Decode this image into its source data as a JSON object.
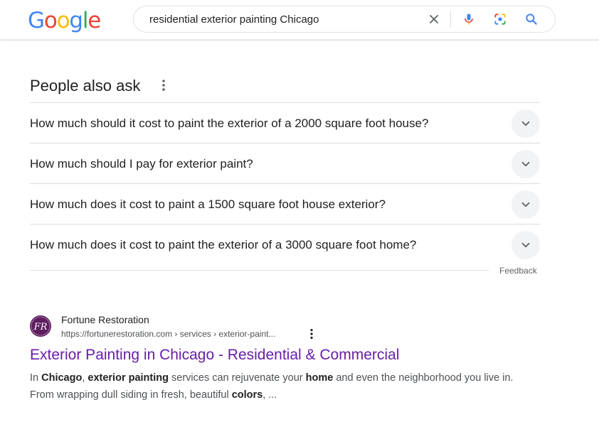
{
  "logo": {
    "letters": [
      "G",
      "o",
      "o",
      "g",
      "l",
      "e"
    ],
    "colors": [
      "#4285F4",
      "#EA4335",
      "#FBBC05",
      "#4285F4",
      "#34A853",
      "#EA4335"
    ]
  },
  "search": {
    "query": "residential exterior painting Chicago",
    "icons": [
      "close-icon",
      "microphone-icon",
      "google-lens-icon",
      "search-icon"
    ]
  },
  "people_also_ask": {
    "title": "People also ask",
    "menu_icon": "more-vertical-icon",
    "questions": [
      "How much should it cost to paint the exterior of a 2000 square foot house?",
      "How much should I pay for exterior paint?",
      "How much does it cost to paint a 1500 square foot house exterior?",
      "How much does it cost to paint the exterior of a 3000 square foot home?"
    ],
    "expand_icon": "chevron-down-icon",
    "feedback": "Feedback"
  },
  "result": {
    "favicon_letter": "FR",
    "favicon_color": "#5d1d5f",
    "site_name": "Fortune Restoration",
    "url": "https://fortunerestoration.com › services › exterior-paint...",
    "title": "Exterior Painting in Chicago - Residential & Commercial",
    "title_color": "#681da8",
    "snippet": {
      "t1": "In ",
      "b1": "Chicago",
      "t2": ", ",
      "b2": "exterior painting",
      "t3": " services can rejuvenate your ",
      "b3": "home",
      "t4": " and even the neighborhood you live in. From wrapping dull siding in fresh, beautiful ",
      "b4": "colors",
      "t5": ", ..."
    }
  }
}
